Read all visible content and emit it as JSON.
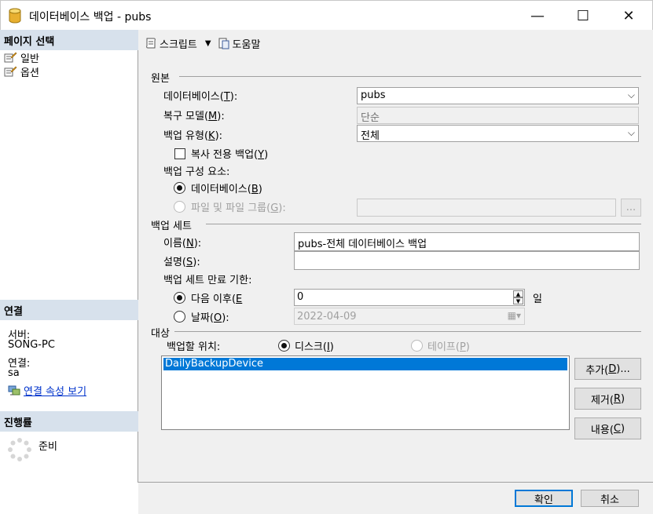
{
  "window": {
    "title": "데이터베이스 백업 - pubs",
    "minimize_glyph": "—",
    "maximize_glyph": "☐",
    "close_glyph": "✕"
  },
  "left": {
    "page_select_header": "페이지 선택",
    "nav_items": [
      {
        "label": "일반",
        "icon": "page-icon"
      },
      {
        "label": "옵션",
        "icon": "page-icon"
      }
    ],
    "connection_header": "연결",
    "server_label": "서버:",
    "server_value": "SONG-PC",
    "connection_label": "연결:",
    "connection_value": "sa",
    "connection_link": "연결 속성 보기",
    "progress_header": "진행률",
    "progress_status": "준비"
  },
  "toolbar": {
    "script_label": "스크립트",
    "help_label": "도움말"
  },
  "source": {
    "title": "원본",
    "database_label_pre": "데이터베이스(",
    "database_label_key": "T",
    "database_label_post": "):",
    "database_value": "pubs",
    "recovery_label_pre": "복구 모델(",
    "recovery_label_key": "M",
    "recovery_label_post": "):",
    "recovery_value": "단순",
    "backup_type_label_pre": "백업 유형(",
    "backup_type_label_key": "K",
    "backup_type_label_post": "):",
    "backup_type_value": "전체",
    "copy_only_pre": "복사 전용 백업(",
    "copy_only_key": "Y",
    "copy_only_post": ")",
    "copy_only_checked": false,
    "component_label": "백업 구성 요소:",
    "component_db_pre": "데이터베이스(",
    "component_db_key": "B",
    "component_db_post": ")",
    "component_files_pre": "파일 및 파일 그룹(",
    "component_files_key": "G",
    "component_files_post": "):",
    "files_browse": "..."
  },
  "backup_set": {
    "title": "백업 세트",
    "name_label_pre": "이름(",
    "name_label_key": "N",
    "name_label_post": "):",
    "name_value": "pubs-전체 데이터베이스 백업",
    "desc_label_pre": "설명(",
    "desc_label_key": "S",
    "desc_label_post": "):",
    "desc_value": "",
    "expire_label": "백업 세트 만료 기한:",
    "after_pre": "다음 이후(",
    "after_key": "E",
    "after_value": "0",
    "after_unit": "일",
    "on_date_pre": "날짜(",
    "on_date_key": "O",
    "on_date_post": "):",
    "date_value": "2022-04-09"
  },
  "destination": {
    "title": "대상",
    "backup_to_label": "백업할 위치:",
    "disk_pre": "디스크(",
    "disk_key": "I",
    "disk_post": ")",
    "tape_pre": "테이프(",
    "tape_key": "P",
    "tape_post": ")",
    "items": [
      "DailyBackupDevice"
    ],
    "add_pre": "추가(",
    "add_key": "D",
    "add_post": ")...",
    "remove_pre": "제거(",
    "remove_key": "R",
    "remove_post": ")",
    "contents_pre": "내용(",
    "contents_key": "C",
    "contents_post": ")"
  },
  "footer": {
    "ok_label": "확인",
    "cancel_label": "취소"
  },
  "colors": {
    "selection": "#0078d7",
    "header_bg": "#d7e1ec",
    "link": "#0033cc",
    "panel_bg": "#f0f0f0"
  }
}
